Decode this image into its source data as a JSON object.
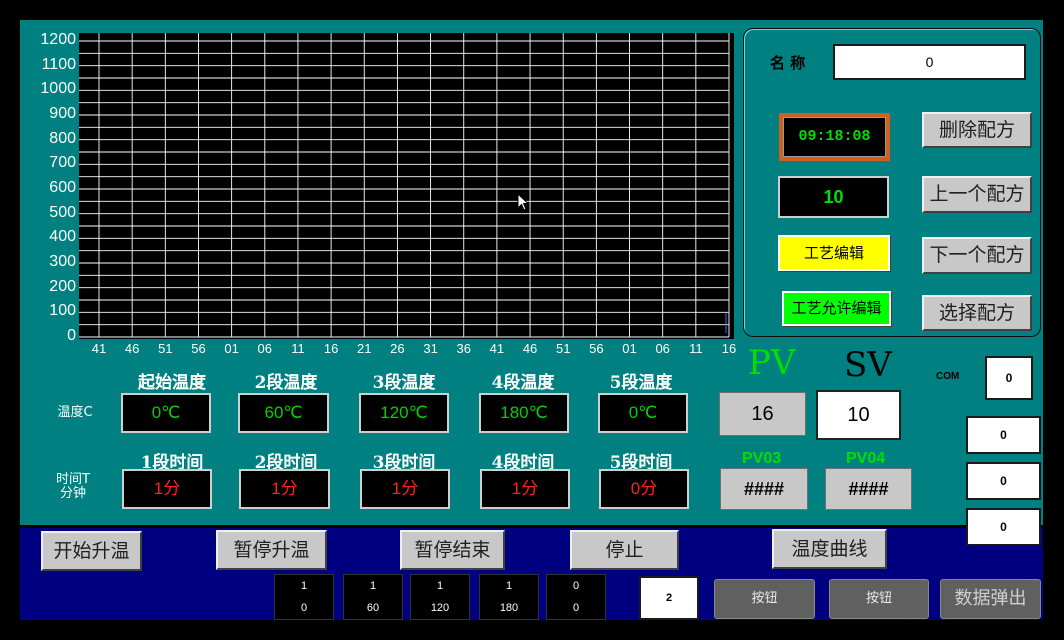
{
  "chart_data": {
    "type": "line",
    "y_ticks": [
      "1200",
      "1100",
      "1000",
      "900",
      "800",
      "700",
      "600",
      "500",
      "400",
      "300",
      "200",
      "100",
      "0"
    ],
    "x_ticks": [
      "41",
      "46",
      "51",
      "56",
      "01",
      "06",
      "11",
      "16",
      "21",
      "26",
      "31",
      "36",
      "41",
      "46",
      "51",
      "56",
      "01",
      "06",
      "11",
      "16"
    ],
    "ylim": [
      0,
      1200
    ],
    "grid": true,
    "series": []
  },
  "recipe": {
    "name_label": "名 称",
    "name_value": "0",
    "clock": "09:18:08",
    "recipe_number": "10",
    "delete_btn": "删除配方",
    "prev_btn": "上一个配方",
    "next_btn": "下一个配方",
    "select_btn": "选择配方",
    "edit_btn": "工艺编辑",
    "allow_edit_btn": "工艺允许编辑"
  },
  "segments": {
    "temp_row_label": "温度C",
    "time_row_label_1": "时间T",
    "time_row_label_2": "分钟",
    "temp_headers": [
      "起始温度",
      "2段温度",
      "3段温度",
      "4段温度",
      "5段温度"
    ],
    "temp_values": [
      "0℃",
      "60℃",
      "120℃",
      "180℃",
      "0℃"
    ],
    "time_headers": [
      "1段时间",
      "2段时间",
      "3段时间",
      "4段时间",
      "5段时间"
    ],
    "time_values": [
      "1分",
      "1分",
      "1分",
      "1分",
      "0分"
    ]
  },
  "process": {
    "pv_label": "PV",
    "sv_label": "SV",
    "pv_value": "16",
    "sv_value": "10",
    "pv03_label": "PV03",
    "pv04_label": "PV04",
    "pv03_value": "####",
    "pv04_value": "####",
    "com_label": "COM",
    "com_value": "0",
    "side_values": [
      "0",
      "0",
      "0"
    ]
  },
  "controls": {
    "start_btn": "开始升温",
    "pause_heat_btn": "暂停升温",
    "pause_end_btn": "暂停结束",
    "stop_btn": "停止",
    "curve_btn": "温度曲线",
    "data_popup_btn": "数据弹出",
    "button_a": "按钮",
    "button_b": "按钮",
    "page_value": "2",
    "cells": [
      {
        "top": "1",
        "bottom": "0"
      },
      {
        "top": "1",
        "bottom": "60"
      },
      {
        "top": "1",
        "bottom": "120"
      },
      {
        "top": "1",
        "bottom": "180"
      },
      {
        "top": "0",
        "bottom": "0"
      }
    ]
  }
}
